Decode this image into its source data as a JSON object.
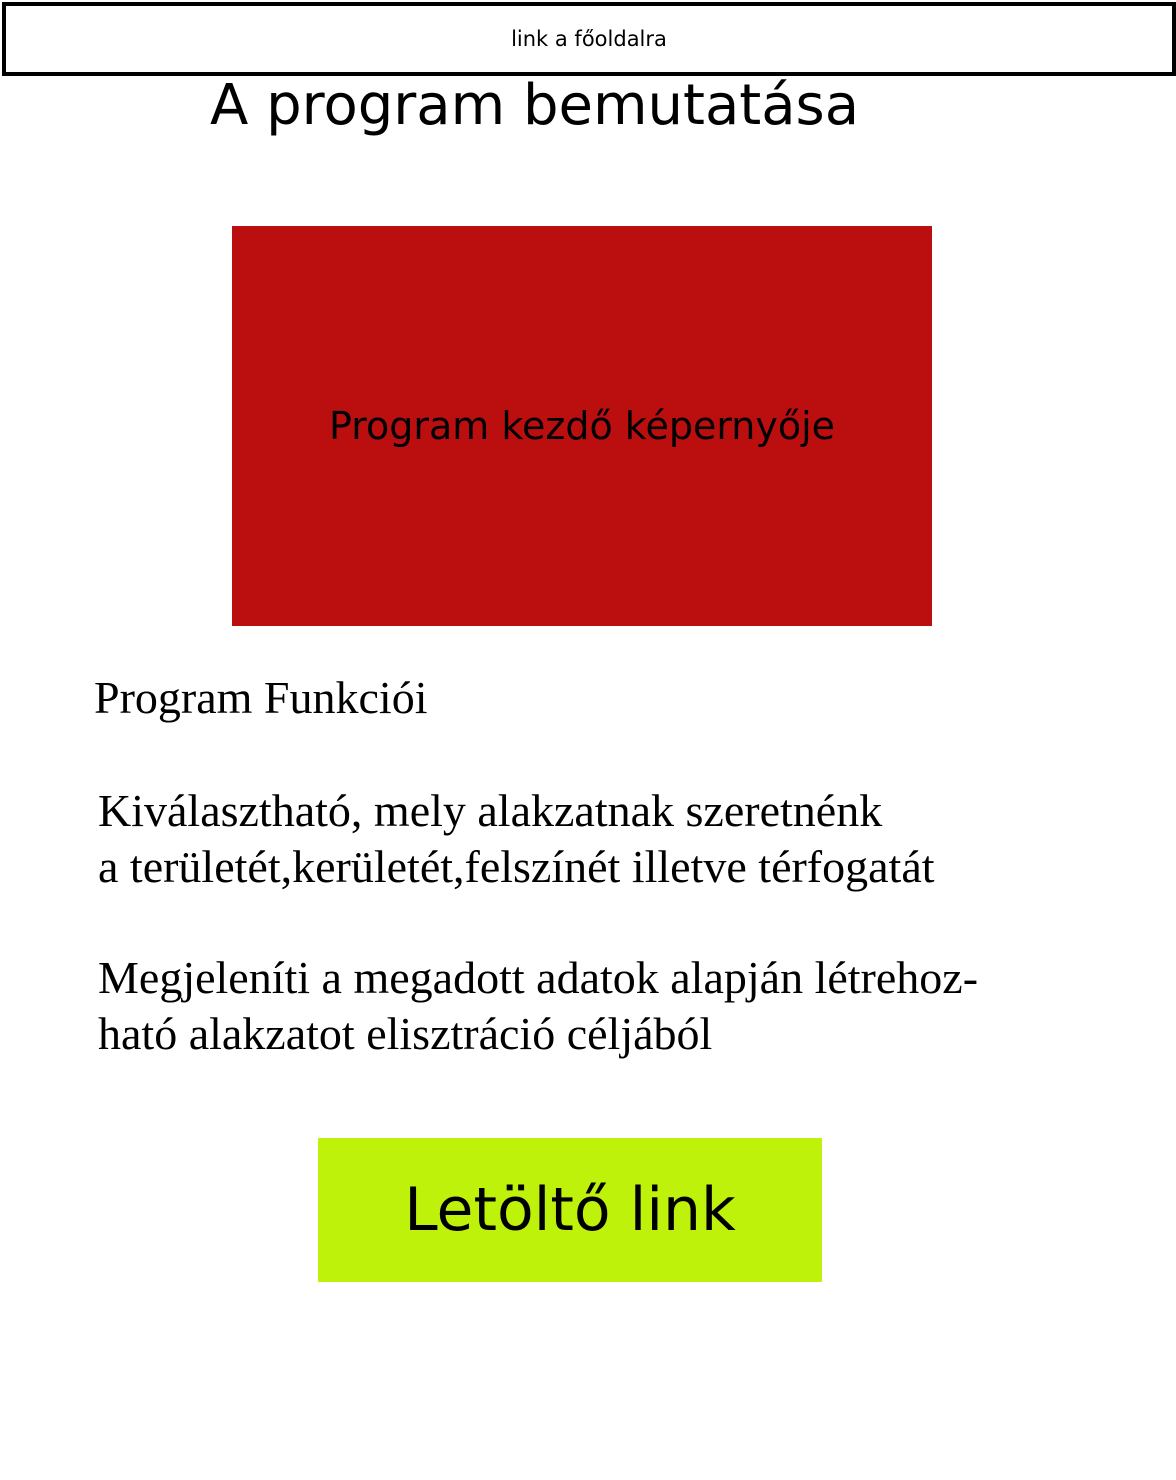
{
  "nav": {
    "home_link_label": "link a főoldalra"
  },
  "header": {
    "title": "A program bemutatása"
  },
  "preview": {
    "label": "Program kezdő képernyője",
    "background_color": "#bb0f0f"
  },
  "features": {
    "heading": "Program Funkciói",
    "items": [
      {
        "line1": "Kiválasztható, mely alakzatnak szeretnénk",
        "line2": "a területét,kerületét,felszínét illetve térfogatát"
      },
      {
        "line1": "Megjeleníti a megadott adatok alapján létrehoz-",
        "line2": "ható alakzatot elisztráció céljából"
      }
    ]
  },
  "download": {
    "label": "Letöltő link",
    "background_color": "#bef20a"
  }
}
